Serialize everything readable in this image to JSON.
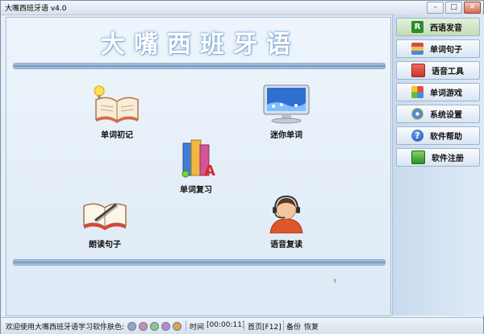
{
  "window": {
    "title": "大嘴西班牙语 v4.0",
    "controls": [
      "minimize",
      "maximize",
      "close"
    ]
  },
  "main": {
    "app_title": "大嘴西班牙语",
    "features": [
      {
        "label": "单词初记",
        "icon": "open-book-lightbulb-icon"
      },
      {
        "label": "迷你单词",
        "icon": "monitor-icon"
      },
      {
        "label": "单词复习",
        "icon": "books-icon"
      },
      {
        "label": "朗读句子",
        "icon": "book-pen-icon"
      },
      {
        "label": "语音复读",
        "icon": "headset-operator-icon"
      }
    ],
    "stray_mark": "ı"
  },
  "sidebar": {
    "items": [
      {
        "label": "西语发音",
        "icon": "r-icon"
      },
      {
        "label": "单词句子",
        "icon": "book-stack-icon"
      },
      {
        "label": "语音工具",
        "icon": "toolbox-icon"
      },
      {
        "label": "单词游戏",
        "icon": "puzzle-icon"
      },
      {
        "label": "系统设置",
        "icon": "gear-icon"
      },
      {
        "label": "软件帮助",
        "icon": "help-icon"
      },
      {
        "label": "软件注册",
        "icon": "register-icon"
      }
    ]
  },
  "status": {
    "welcome": "欢迎使用大嘴西班牙语学习软件",
    "skin_label": "肤色:",
    "skins": [
      "#8fa7c4",
      "#c98fb2",
      "#8cc58c",
      "#b58bd0",
      "#e0a24a"
    ],
    "time_label": "时间",
    "time_value": "[00:00:11]",
    "home_label": "首页[F12]",
    "backup_label": "备份",
    "restore_label": "恢复"
  }
}
